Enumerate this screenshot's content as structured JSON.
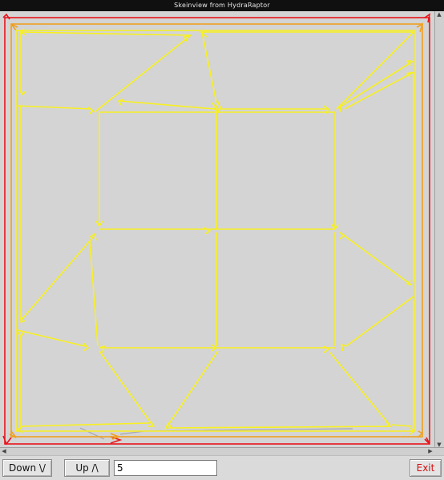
{
  "window": {
    "title": "Skeinview from HydraRaptor"
  },
  "canvas": {
    "background": "#d4d4d4",
    "colors": {
      "outer_perimeter": "#e8141c",
      "inner_perimeter": "#f0a020",
      "infill": "#f8f020",
      "travel": "#a8a8a8"
    }
  },
  "controls": {
    "down_label": "Down \\/",
    "up_label": "Up /\\",
    "layer_value": "5",
    "exit_label": "Exit"
  }
}
